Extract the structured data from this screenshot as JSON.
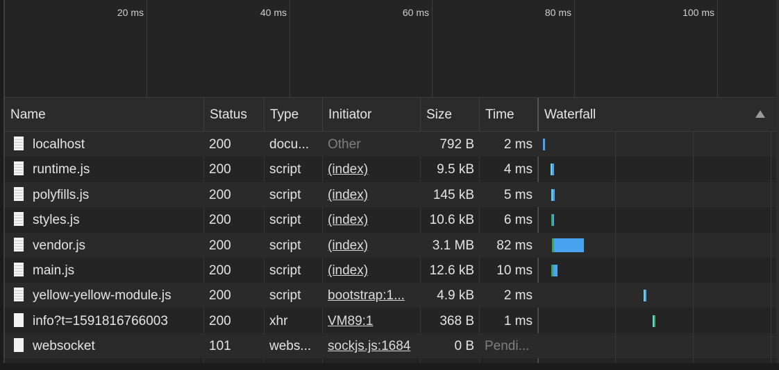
{
  "overview": {
    "ticks": [
      "20 ms",
      "40 ms",
      "60 ms",
      "80 ms",
      "100 ms"
    ]
  },
  "columns": {
    "name": "Name",
    "status": "Status",
    "type": "Type",
    "initiator": "Initiator",
    "size": "Size",
    "time": "Time",
    "waterfall": "Waterfall"
  },
  "colors": {
    "waiting": "#3ba55c",
    "download": "#4aa3f0",
    "pending": "#72d0d8"
  },
  "requests": [
    {
      "name": "localhost",
      "status": "200",
      "type": "docu...",
      "initiator": "Other",
      "initiator_link": false,
      "size": "792 B",
      "time": "2 ms",
      "icon": "document-icon"
    },
    {
      "name": "runtime.js",
      "status": "200",
      "type": "script",
      "initiator": "(index)",
      "initiator_link": true,
      "size": "9.5 kB",
      "time": "4 ms",
      "icon": "script-file-icon"
    },
    {
      "name": "polyfills.js",
      "status": "200",
      "type": "script",
      "initiator": "(index)",
      "initiator_link": true,
      "size": "145 kB",
      "time": "5 ms",
      "icon": "script-file-icon"
    },
    {
      "name": "styles.js",
      "status": "200",
      "type": "script",
      "initiator": "(index)",
      "initiator_link": true,
      "size": "10.6 kB",
      "time": "6 ms",
      "icon": "script-file-icon"
    },
    {
      "name": "vendor.js",
      "status": "200",
      "type": "script",
      "initiator": "(index)",
      "initiator_link": true,
      "size": "3.1 MB",
      "time": "82 ms",
      "icon": "script-file-icon"
    },
    {
      "name": "main.js",
      "status": "200",
      "type": "script",
      "initiator": "(index)",
      "initiator_link": true,
      "size": "12.6 kB",
      "time": "10 ms",
      "icon": "script-file-icon"
    },
    {
      "name": "yellow-yellow-module.js",
      "status": "200",
      "type": "script",
      "initiator": "bootstrap:1...",
      "initiator_link": true,
      "size": "4.9 kB",
      "time": "2 ms",
      "icon": "script-file-icon"
    },
    {
      "name": "info?t=1591816766003",
      "status": "200",
      "type": "xhr",
      "initiator": "VM89:1",
      "initiator_link": true,
      "size": "368 B",
      "time": "1 ms",
      "icon": "xhr-file-icon"
    },
    {
      "name": "websocket",
      "status": "101",
      "type": "webs...",
      "initiator": "sockjs.js:1684",
      "initiator_link": true,
      "size": "0 B",
      "time": "Pendi...",
      "icon": "websocket-file-icon",
      "time_muted": true
    }
  ]
}
